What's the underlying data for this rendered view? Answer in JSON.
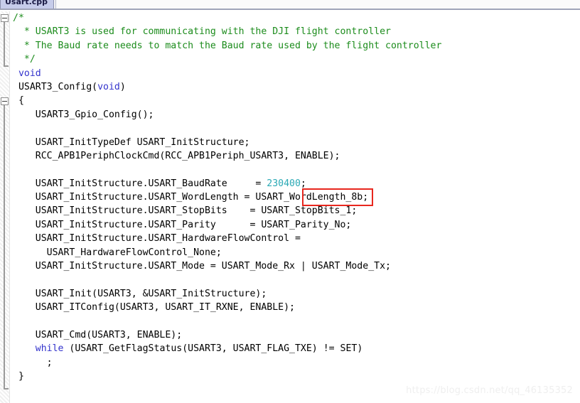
{
  "window": {
    "tab_label": "Usart.cpp"
  },
  "colors": {
    "comment": "#1c8c1c",
    "keyword": "#3333cc",
    "number": "#2aa9b5",
    "plain": "#000000",
    "highlight_border": "#e8271e",
    "editor_background": "#ffffff",
    "tab_active_background": "#c6ccea",
    "gutter_background": "#f0f0f0",
    "watermark": "#efefef"
  },
  "editor": {
    "language": "c",
    "fold_markers": [
      {
        "name": "comment-block-fold",
        "state": "expanded",
        "glyph": "minus"
      },
      {
        "name": "function-body-fold",
        "state": "expanded",
        "glyph": "minus"
      }
    ],
    "highlight": {
      "name": "baud-rate-highlight",
      "text": "230400;",
      "shape": "rectangle",
      "color": "#e8271e"
    },
    "lines": [
      {
        "n": 1,
        "text": "/*"
      },
      {
        "n": 2,
        "text": "  * USART3 is used for communicating with the DJI flight controller"
      },
      {
        "n": 3,
        "text": "  * The Baud rate needs to match the Baud rate used by the flight controller"
      },
      {
        "n": 4,
        "text": "  */"
      },
      {
        "n": 5,
        "text": " void"
      },
      {
        "n": 6,
        "text": " USART3_Config(void)"
      },
      {
        "n": 7,
        "text": " {"
      },
      {
        "n": 8,
        "text": "    USART3_Gpio_Config();"
      },
      {
        "n": 9,
        "text": ""
      },
      {
        "n": 10,
        "text": "    USART_InitTypeDef USART_InitStructure;"
      },
      {
        "n": 11,
        "text": "    RCC_APB1PeriphClockCmd(RCC_APB1Periph_USART3, ENABLE);"
      },
      {
        "n": 12,
        "text": ""
      },
      {
        "n": 13,
        "text": "    USART_InitStructure.USART_BaudRate     = 230400;"
      },
      {
        "n": 14,
        "text": "    USART_InitStructure.USART_WordLength = USART_WordLength_8b;"
      },
      {
        "n": 15,
        "text": "    USART_InitStructure.USART_StopBits    = USART_StopBits_1;"
      },
      {
        "n": 16,
        "text": "    USART_InitStructure.USART_Parity      = USART_Parity_No;"
      },
      {
        "n": 17,
        "text": "    USART_InitStructure.USART_HardwareFlowControl ="
      },
      {
        "n": 18,
        "text": "      USART_HardwareFlowControl_None;"
      },
      {
        "n": 19,
        "text": "    USART_InitStructure.USART_Mode = USART_Mode_Rx | USART_Mode_Tx;"
      },
      {
        "n": 20,
        "text": ""
      },
      {
        "n": 21,
        "text": "    USART_Init(USART3, &USART_InitStructure);"
      },
      {
        "n": 22,
        "text": "    USART_ITConfig(USART3, USART_IT_RXNE, ENABLE);"
      },
      {
        "n": 23,
        "text": ""
      },
      {
        "n": 24,
        "text": "    USART_Cmd(USART3, ENABLE);"
      },
      {
        "n": 25,
        "text": "    while (USART_GetFlagStatus(USART3, USART_FLAG_TXE) != SET)"
      },
      {
        "n": 26,
        "text": "      ;"
      },
      {
        "n": 27,
        "text": " }"
      }
    ],
    "segments": [
      [
        {
          "t": "/*",
          "c": "cmt"
        }
      ],
      [
        {
          "t": "  * USART3 is used for communicating with the DJI flight controller",
          "c": "cmt"
        }
      ],
      [
        {
          "t": "  * The Baud rate needs to match the Baud rate used by the flight controller",
          "c": "cmt"
        }
      ],
      [
        {
          "t": "  */",
          "c": "cmt"
        }
      ],
      [
        {
          "t": " ",
          "c": "pln"
        },
        {
          "t": "void",
          "c": "kw"
        }
      ],
      [
        {
          "t": " USART3_Config(",
          "c": "pln"
        },
        {
          "t": "void",
          "c": "kw"
        },
        {
          "t": ")",
          "c": "pln"
        }
      ],
      [
        {
          "t": " {",
          "c": "pln"
        }
      ],
      [
        {
          "t": "    USART3_Gpio_Config();",
          "c": "pln"
        }
      ],
      [
        {
          "t": "",
          "c": "pln"
        }
      ],
      [
        {
          "t": "    USART_InitTypeDef USART_InitStructure;",
          "c": "pln"
        }
      ],
      [
        {
          "t": "    RCC_APB1PeriphClockCmd(RCC_APB1Periph_USART3, ENABLE);",
          "c": "pln"
        }
      ],
      [
        {
          "t": "",
          "c": "pln"
        }
      ],
      [
        {
          "t": "    USART_InitStructure.USART_BaudRate     = ",
          "c": "pln"
        },
        {
          "t": "230400",
          "c": "num"
        },
        {
          "t": ";",
          "c": "pln"
        }
      ],
      [
        {
          "t": "    USART_InitStructure.USART_WordLength = USART_WordLength_8b;",
          "c": "pln"
        }
      ],
      [
        {
          "t": "    USART_InitStructure.USART_StopBits    = USART_StopBits_1;",
          "c": "pln"
        }
      ],
      [
        {
          "t": "    USART_InitStructure.USART_Parity      = USART_Parity_No;",
          "c": "pln"
        }
      ],
      [
        {
          "t": "    USART_InitStructure.USART_HardwareFlowControl =",
          "c": "pln"
        }
      ],
      [
        {
          "t": "      USART_HardwareFlowControl_None;",
          "c": "pln"
        }
      ],
      [
        {
          "t": "    USART_InitStructure.USART_Mode = USART_Mode_Rx | USART_Mode_Tx;",
          "c": "pln"
        }
      ],
      [
        {
          "t": "",
          "c": "pln"
        }
      ],
      [
        {
          "t": "    USART_Init(USART3, &USART_InitStructure);",
          "c": "pln"
        }
      ],
      [
        {
          "t": "    USART_ITConfig(USART3, USART_IT_RXNE, ENABLE);",
          "c": "pln"
        }
      ],
      [
        {
          "t": "",
          "c": "pln"
        }
      ],
      [
        {
          "t": "    USART_Cmd(USART3, ENABLE);",
          "c": "pln"
        }
      ],
      [
        {
          "t": "    ",
          "c": "pln"
        },
        {
          "t": "while",
          "c": "kw"
        },
        {
          "t": " (USART_GetFlagStatus(USART3, USART_FLAG_TXE) != SET)",
          "c": "pln"
        }
      ],
      [
        {
          "t": "      ;",
          "c": "pln"
        }
      ],
      [
        {
          "t": " }",
          "c": "pln"
        }
      ]
    ]
  },
  "watermark": {
    "text": "https://blog.csdn.net/qq_46135352"
  }
}
